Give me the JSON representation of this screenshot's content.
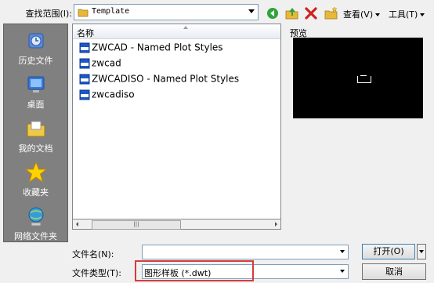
{
  "lookin": {
    "label": "查找范围(I):",
    "value": "Template"
  },
  "toolbar": {
    "views_label": "查看(V)",
    "tools_label": "工具(T)"
  },
  "places": [
    {
      "label": "历史文件",
      "icon": "history-icon"
    },
    {
      "label": "桌面",
      "icon": "desktop-icon"
    },
    {
      "label": "我的文档",
      "icon": "documents-icon"
    },
    {
      "label": "收藏夹",
      "icon": "favorites-icon"
    },
    {
      "label": "网络文件夹",
      "icon": "network-icon"
    }
  ],
  "filelist": {
    "column_name": "名称",
    "files": [
      "ZWCAD - Named Plot Styles",
      "zwcad",
      "ZWCADISO - Named Plot Styles",
      "zwcadiso"
    ]
  },
  "preview": {
    "label": "预览"
  },
  "filename": {
    "label": "文件名(N):",
    "value": ""
  },
  "filetype": {
    "label": "文件类型(T):",
    "value": "图形样板 (*.dwt)"
  },
  "buttons": {
    "open": "打开(O)",
    "cancel": "取消"
  },
  "colors": {
    "highlight": "#d53c3c",
    "places_bg": "#808080"
  }
}
